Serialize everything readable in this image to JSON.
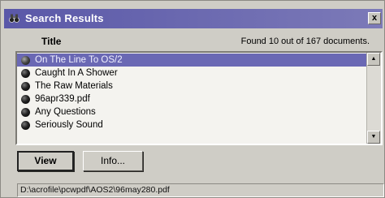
{
  "window": {
    "title": "Search Results",
    "close_glyph": "x"
  },
  "header": {
    "column_title": "Title",
    "found_text": "Found 10 out of 167 documents."
  },
  "results": [
    {
      "label": "On The Line To OS/2",
      "selected": true
    },
    {
      "label": "Caught In A Shower",
      "selected": false
    },
    {
      "label": "The Raw Materials",
      "selected": false
    },
    {
      "label": "96apr339.pdf",
      "selected": false
    },
    {
      "label": "Any Questions",
      "selected": false
    },
    {
      "label": "Seriously Sound",
      "selected": false
    }
  ],
  "scrollbar": {
    "up_glyph": "▲",
    "down_glyph": "▼"
  },
  "buttons": {
    "view_label": "View",
    "info_label": "Info..."
  },
  "status": {
    "path": "D:\\acrofile\\pcwpdf\\AOS2\\96may280.pdf"
  },
  "colors": {
    "titlebar": "#5a58a8",
    "selection": "#6a68b4"
  }
}
